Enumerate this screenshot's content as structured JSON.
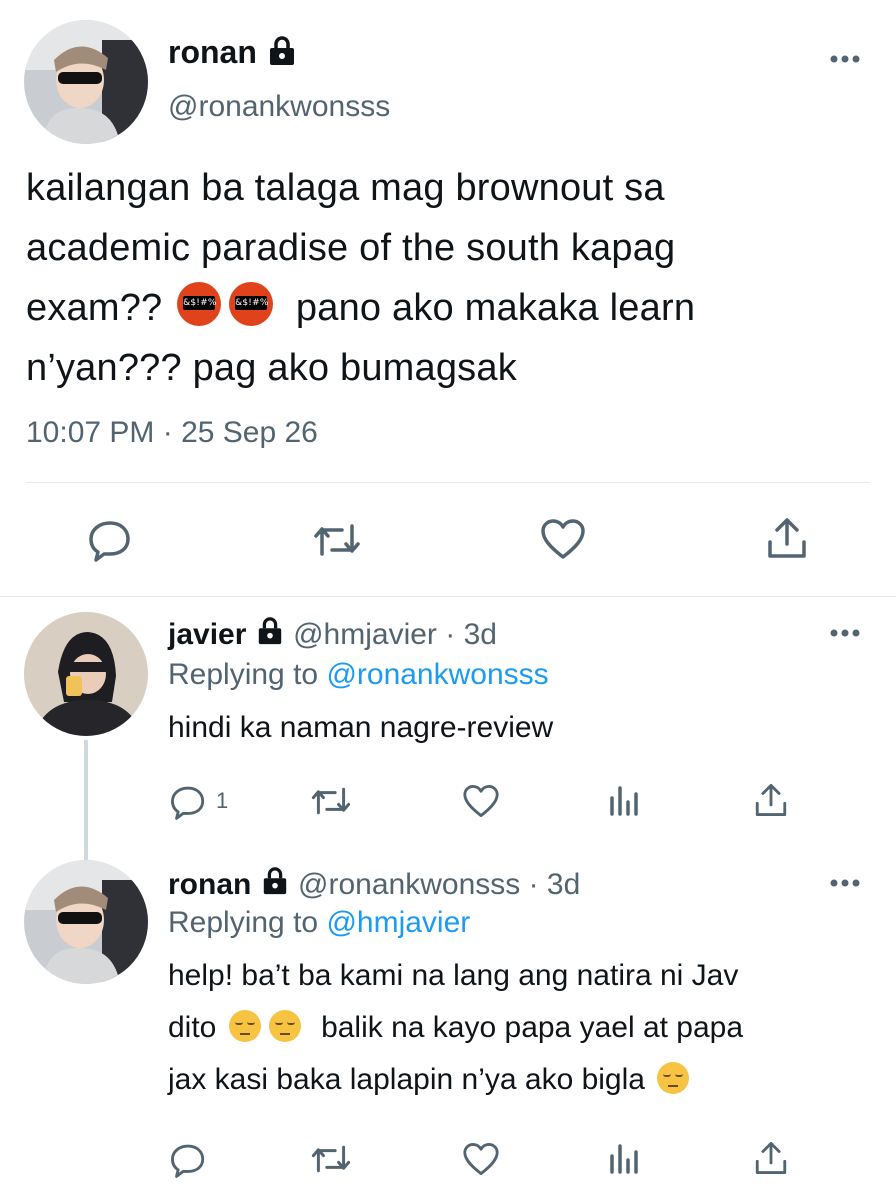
{
  "main_tweet": {
    "author": {
      "name": "ronan",
      "handle": "@ronankwonsss",
      "lock_icon": "lock-icon",
      "avatar_colors": [
        "#c9ccd0",
        "#7a8088"
      ]
    },
    "text_line1": "kailangan ba talaga mag brownout sa",
    "text_line2": "academic paradise of the south kapag",
    "text_line3a": "exam??",
    "emoji_angry": "&$!#%",
    "text_line3b": "pano ako makaka learn",
    "text_line4": "n’yan??? pag ako bumagsak",
    "timestamp": "10:07 PM · 25 Sep 26",
    "actions": [
      "reply-icon",
      "retweet-icon",
      "like-icon",
      "share-icon"
    ]
  },
  "replies": [
    {
      "name": "javier",
      "handle": "@hmjavier",
      "time": "· 3d",
      "replying_label": "Replying to",
      "replying_to": "@ronankwonsss",
      "text": "hindi ka naman nagre-review",
      "reply_count": "1",
      "avatar_colors": [
        "#d8cfc2",
        "#1e1e22"
      ]
    },
    {
      "name": "ronan",
      "handle": "@ronankwonsss",
      "time": "· 3d",
      "replying_label": "Replying to",
      "replying_to": "@hmjavier",
      "text_line1": "help! ba’t ba kami na lang ang natira ni Jav",
      "text_line2a": "dito",
      "text_line2b": "balik na kayo papa yael at papa",
      "text_line3": "jax kasi baka laplapin n’ya ako bigla",
      "avatar_colors": [
        "#c9ccd0",
        "#7a8088"
      ]
    }
  ],
  "colors": {
    "text": "#0f1419",
    "secondary": "#536471",
    "link": "#1d9bf0",
    "divider": "#e6e8ea"
  }
}
